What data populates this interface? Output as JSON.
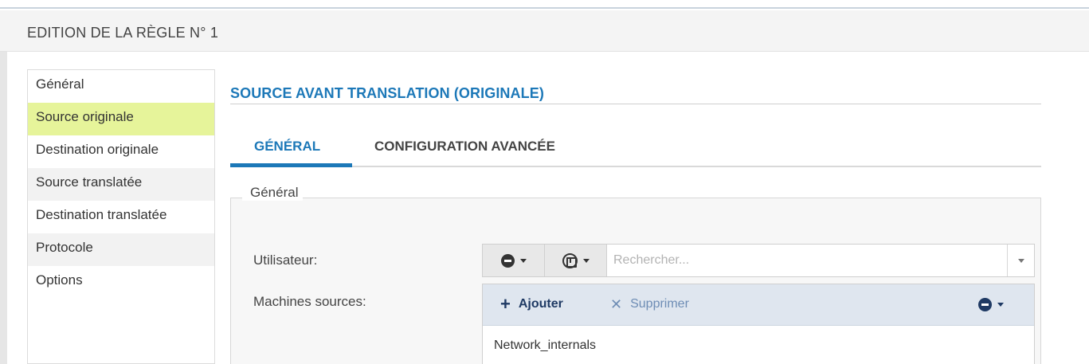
{
  "header": {
    "title": "EDITION DE LA RÈGLE N° 1"
  },
  "sidebar": {
    "items": [
      {
        "label": "Général",
        "active": false
      },
      {
        "label": "Source originale",
        "active": true
      },
      {
        "label": "Destination originale",
        "active": false
      },
      {
        "label": "Source translatée",
        "active": false
      },
      {
        "label": "Destination translatée",
        "active": false
      },
      {
        "label": "Protocole",
        "active": false
      },
      {
        "label": "Options",
        "active": false
      }
    ]
  },
  "section": {
    "title": "SOURCE AVANT TRANSLATION (ORIGINALE)"
  },
  "tabs": [
    {
      "label": "GÉNÉRAL",
      "active": true
    },
    {
      "label": "CONFIGURATION AVANCÉE",
      "active": false
    }
  ],
  "general": {
    "legend": "Général",
    "user_label": "Utilisateur:",
    "user_search_placeholder": "Rechercher...",
    "machines_label": "Machines sources:"
  },
  "grid": {
    "add_label": "Ajouter",
    "delete_label": "Supprimer",
    "rows": [
      "Network_internals"
    ]
  },
  "colors": {
    "accent": "#1c78b8",
    "active_sidebar": "#e6f49a",
    "toolbar_bg": "#dfe6ef",
    "add_color": "#1f3a64",
    "delete_color": "#6e8db5"
  },
  "icons": {
    "user_type": "minus-circle-icon",
    "user_directory": "directory-icon",
    "add": "plus-icon",
    "delete": "close-icon",
    "filter": "minus-circle-icon"
  }
}
